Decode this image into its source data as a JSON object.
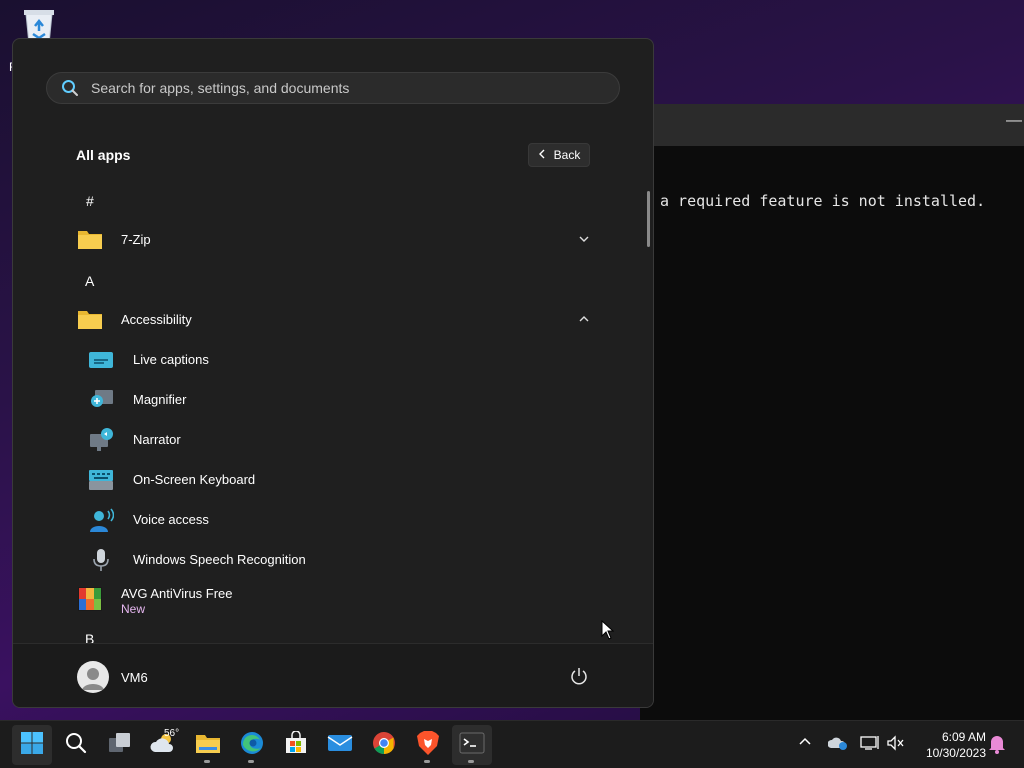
{
  "desktop": {
    "recycle_bin_label": "R"
  },
  "terminal": {
    "output_line": "a required feature is not installed.",
    "minimize_glyph": "—"
  },
  "start_menu": {
    "search": {
      "placeholder": "Search for apps, settings, and documents"
    },
    "title": "All apps",
    "back_label": "Back",
    "list": [
      {
        "type": "letter",
        "label": "#"
      },
      {
        "type": "folder",
        "label": "7-Zip",
        "expanded": false
      },
      {
        "type": "letter",
        "label": "A"
      },
      {
        "type": "folder",
        "label": "Accessibility",
        "expanded": true
      },
      {
        "type": "app",
        "label": "Live captions",
        "icon": "live-captions-icon"
      },
      {
        "type": "app",
        "label": "Magnifier",
        "icon": "magnifier-icon"
      },
      {
        "type": "app",
        "label": "Narrator",
        "icon": "narrator-icon"
      },
      {
        "type": "app",
        "label": "On-Screen Keyboard",
        "icon": "keyboard-icon"
      },
      {
        "type": "app",
        "label": "Voice access",
        "icon": "voice-access-icon"
      },
      {
        "type": "app",
        "label": "Windows Speech Recognition",
        "icon": "microphone-icon"
      },
      {
        "type": "app",
        "label": "AVG AntiVirus Free",
        "badge": "New",
        "icon": "avg-icon"
      },
      {
        "type": "letter",
        "label": "B"
      }
    ],
    "user": {
      "name": "VM6"
    }
  },
  "taskbar": {
    "weather_temp": "56°",
    "pinned": [
      "start-icon",
      "search-icon",
      "task-view-icon",
      "weather-icon",
      "file-explorer-icon",
      "edge-icon",
      "store-icon",
      "mail-icon",
      "chrome-icon",
      "brave-icon",
      "terminal-icon"
    ],
    "clock": {
      "time": "6:09 AM",
      "date": "10/30/2023"
    }
  },
  "colors": {
    "accent": "#60cdff",
    "new_badge": "#e6b7f0",
    "folder": "#f5c542"
  }
}
